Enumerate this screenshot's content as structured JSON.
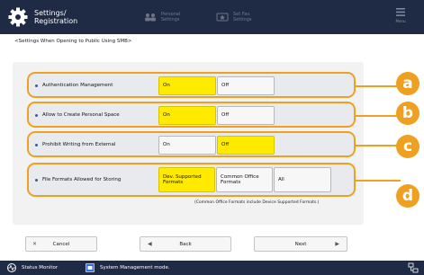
{
  "header": {
    "title_line1": "Settings/",
    "title_line2": "Registration",
    "shortcuts": [
      {
        "line1": "Personal",
        "line2": "Settings",
        "icon": "people-icon"
      },
      {
        "line1": "Set Fav.",
        "line2": "Settings",
        "icon": "favorite-settings-icon"
      }
    ],
    "menu_label": "Menu"
  },
  "breadcrumb": "<Settings When Opening to Public Using SMB>",
  "settings": [
    {
      "label": "Authentication Management",
      "options": [
        "On",
        "Off"
      ],
      "selected": 0
    },
    {
      "label": "Allow to Create Personal Space",
      "options": [
        "On",
        "Off"
      ],
      "selected": 0
    },
    {
      "label": "Prohibit Writing from External",
      "options": [
        "On",
        "Off"
      ],
      "selected": 1
    },
    {
      "label": "File Formats Allowed for Storing",
      "options": [
        "Dev. Supported Formats",
        "Common Office Formats",
        "All"
      ],
      "selected": 0
    }
  ],
  "note": "(Common Office Formats include Device Supported Formats.)",
  "callouts": [
    "a",
    "b",
    "c",
    "d"
  ],
  "buttons": {
    "cancel": "Cancel",
    "back": "Back",
    "next": "Next"
  },
  "status_bar": {
    "monitor": "Status Monitor",
    "mode": "System Management mode."
  },
  "colors": {
    "accent": "#f0a020",
    "selected": "#ffea00",
    "header": "#1f2a44"
  }
}
